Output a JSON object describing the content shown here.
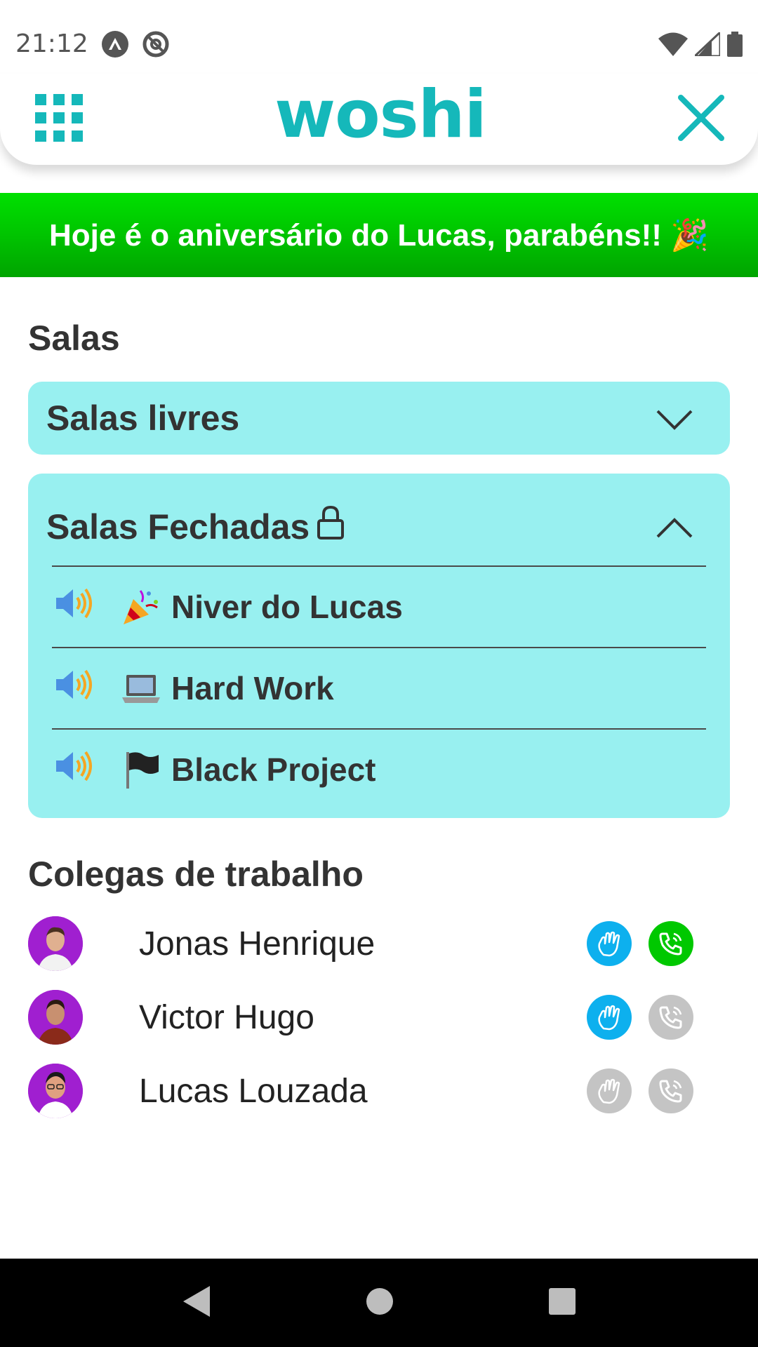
{
  "status_bar": {
    "time": "21:12",
    "left_icons": [
      "app-notification-icon",
      "at-sign-icon"
    ],
    "right_icons": [
      "wifi-icon",
      "cell-signal-icon",
      "battery-icon"
    ]
  },
  "header": {
    "brand": "woshi",
    "menu_icon": "grid-menu-icon",
    "close_icon": "close-icon",
    "accent_color": "#15b8ba"
  },
  "banner": {
    "text": "Hoje é o aniversário do Lucas, parabéns!! 🎉",
    "color": "#00c400"
  },
  "rooms": {
    "title": "Salas",
    "free": {
      "label": "Salas livres",
      "expanded": false
    },
    "closed": {
      "label": "Salas Fechadas",
      "expanded": true,
      "items": [
        {
          "emoji": "party-popper-icon",
          "name": "Niver do Lucas"
        },
        {
          "emoji": "laptop-icon",
          "name": "Hard Work"
        },
        {
          "emoji": "black-flag-icon",
          "name": "Black Project"
        }
      ]
    },
    "panel_color": "#98f0f0"
  },
  "colleagues": {
    "title": "Colegas de trabalho",
    "items": [
      {
        "name": "Jonas Henrique",
        "wave_active": true,
        "call_active": true
      },
      {
        "name": "Victor Hugo",
        "wave_active": true,
        "call_active": false
      },
      {
        "name": "Lucas Louzada",
        "wave_active": false,
        "call_active": false
      }
    ]
  },
  "colors": {
    "wave_active": "#0db0ee",
    "call_active": "#00c800",
    "inactive": "#c4c4c4"
  }
}
